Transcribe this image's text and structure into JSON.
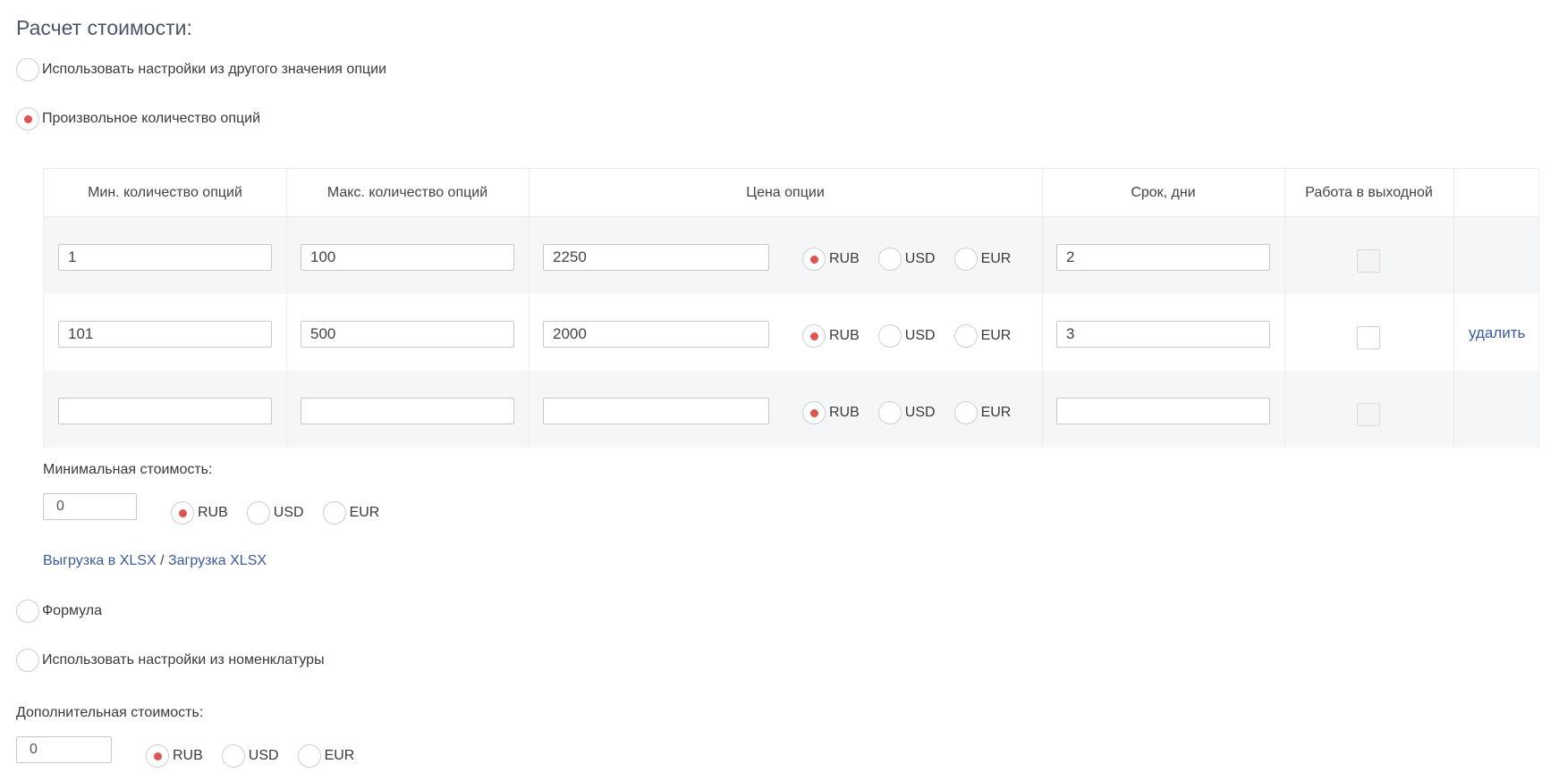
{
  "section_title": "Расчет стоимости:",
  "options": {
    "use_other_value": "Использовать настройки из другого значения опции",
    "custom_quantity": "Произвольное количество опций",
    "formula": "Формула",
    "use_nomenclature": "Использовать настройки из номенклатуры"
  },
  "table": {
    "headers": {
      "min_qty": "Мин. количество опций",
      "max_qty": "Макс. количество опций",
      "price": "Цена опции",
      "term": "Срок, дни",
      "weekend": "Работа в выходной"
    },
    "currencies": [
      "RUB",
      "USD",
      "EUR"
    ],
    "rows": [
      {
        "min": "1",
        "max": "100",
        "price": "2250",
        "currency": "RUB",
        "term": "2",
        "weekend": false,
        "action": ""
      },
      {
        "min": "101",
        "max": "500",
        "price": "2000",
        "currency": "RUB",
        "term": "3",
        "weekend": false,
        "action": "удалить"
      },
      {
        "min": "",
        "max": "",
        "price": "",
        "currency": "RUB",
        "term": "",
        "weekend": false,
        "action": ""
      }
    ]
  },
  "min_cost": {
    "label": "Минимальная стоимость:",
    "value": "0",
    "currency": "RUB"
  },
  "xlsx": {
    "export": "Выгрузка в XLSX",
    "separator": "/",
    "import": "Загрузка XLSX"
  },
  "extra_cost": {
    "label": "Дополнительная стоимость:",
    "value": "0",
    "currency": "RUB"
  },
  "colors": {
    "accent": "#e0534e",
    "link": "#3b5a9a",
    "row_bg": "#f5f6f8"
  }
}
